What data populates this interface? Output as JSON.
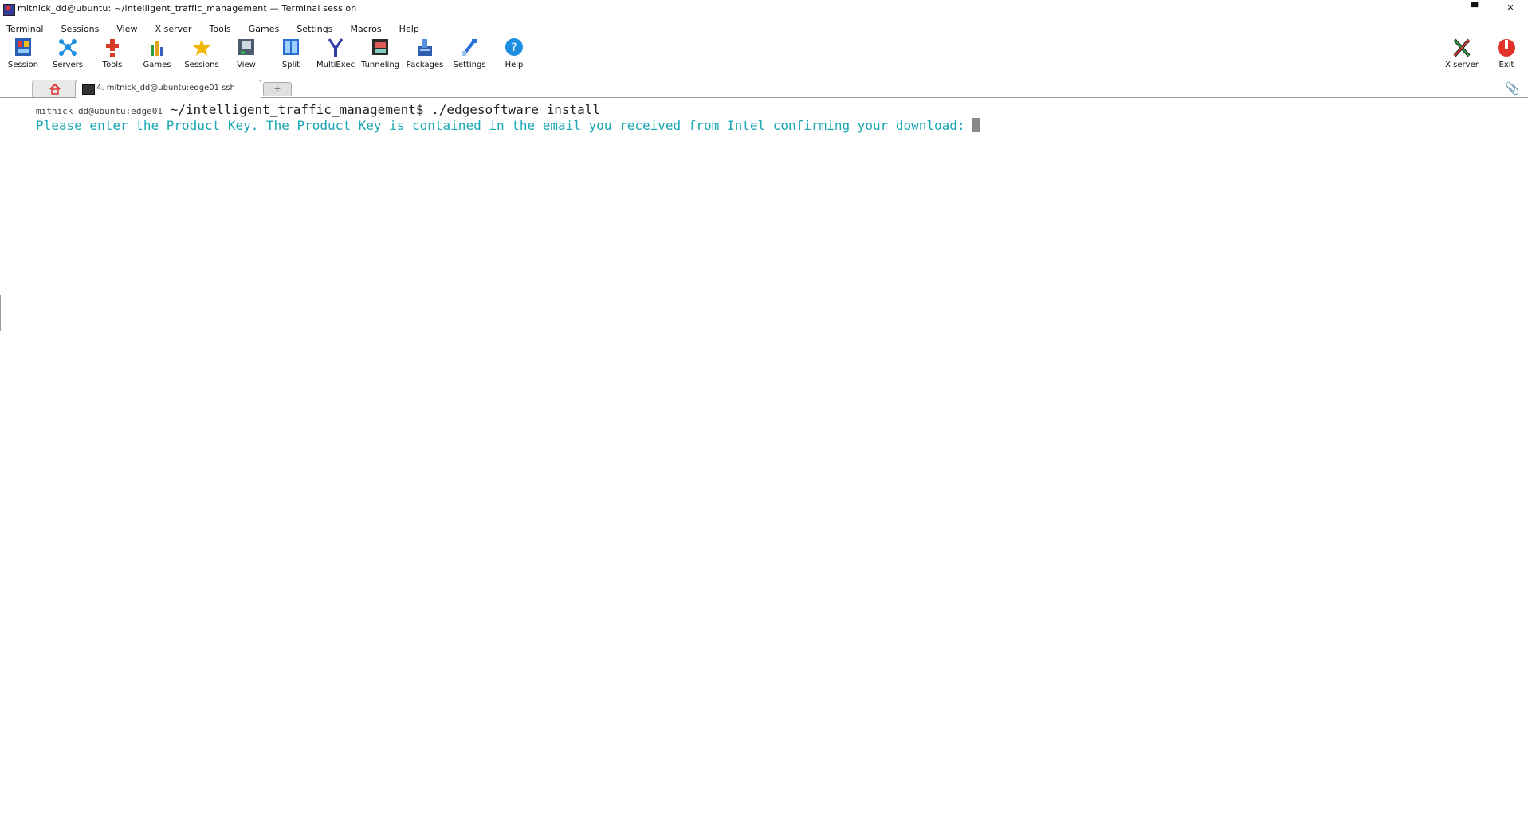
{
  "window": {
    "title": "mitnick_dd@ubuntu: ~/intelligent_traffic_management — Terminal session",
    "buttons": {
      "maximize": "▀",
      "close": "✕"
    }
  },
  "menubar": [
    "Terminal",
    "Sessions",
    "View",
    "X server",
    "Tools",
    "Games",
    "Settings",
    "Macros",
    "Help"
  ],
  "toolbar": {
    "left": [
      {
        "label": "Session",
        "icon": "session-icon"
      },
      {
        "label": "Servers",
        "icon": "servers-icon"
      },
      {
        "label": "Tools",
        "icon": "tools-icon"
      },
      {
        "label": "Games",
        "icon": "games-icon"
      },
      {
        "label": "Sessions",
        "icon": "sessions-star-icon"
      },
      {
        "label": "View",
        "icon": "view-icon"
      },
      {
        "label": "Split",
        "icon": "split-icon"
      },
      {
        "label": "MultiExec",
        "icon": "multiexec-icon"
      },
      {
        "label": "Tunneling",
        "icon": "tunneling-icon"
      },
      {
        "label": "Packages",
        "icon": "packages-icon"
      },
      {
        "label": "Settings",
        "icon": "settings-icon"
      },
      {
        "label": "Help",
        "icon": "help-icon"
      }
    ],
    "right": [
      {
        "label": "X server",
        "icon": "xserver-icon"
      },
      {
        "label": "Exit",
        "icon": "exit-icon"
      }
    ]
  },
  "tabs": {
    "session_label": "4. mitnick_dd@ubuntu:edge01 ssh",
    "new_tab": "+"
  },
  "terminal": {
    "prompt_host": "mitnick_dd@ubuntu:edge01",
    "prompt_path": "~/intelligent_traffic_management$",
    "command": " ./edgesoftware install",
    "output": "Please enter the Product Key. The Product Key is contained in the email you received from Intel confirming your download:"
  },
  "colors": {
    "output_text": "#18a7b3",
    "accent": "#2a6fd6"
  }
}
